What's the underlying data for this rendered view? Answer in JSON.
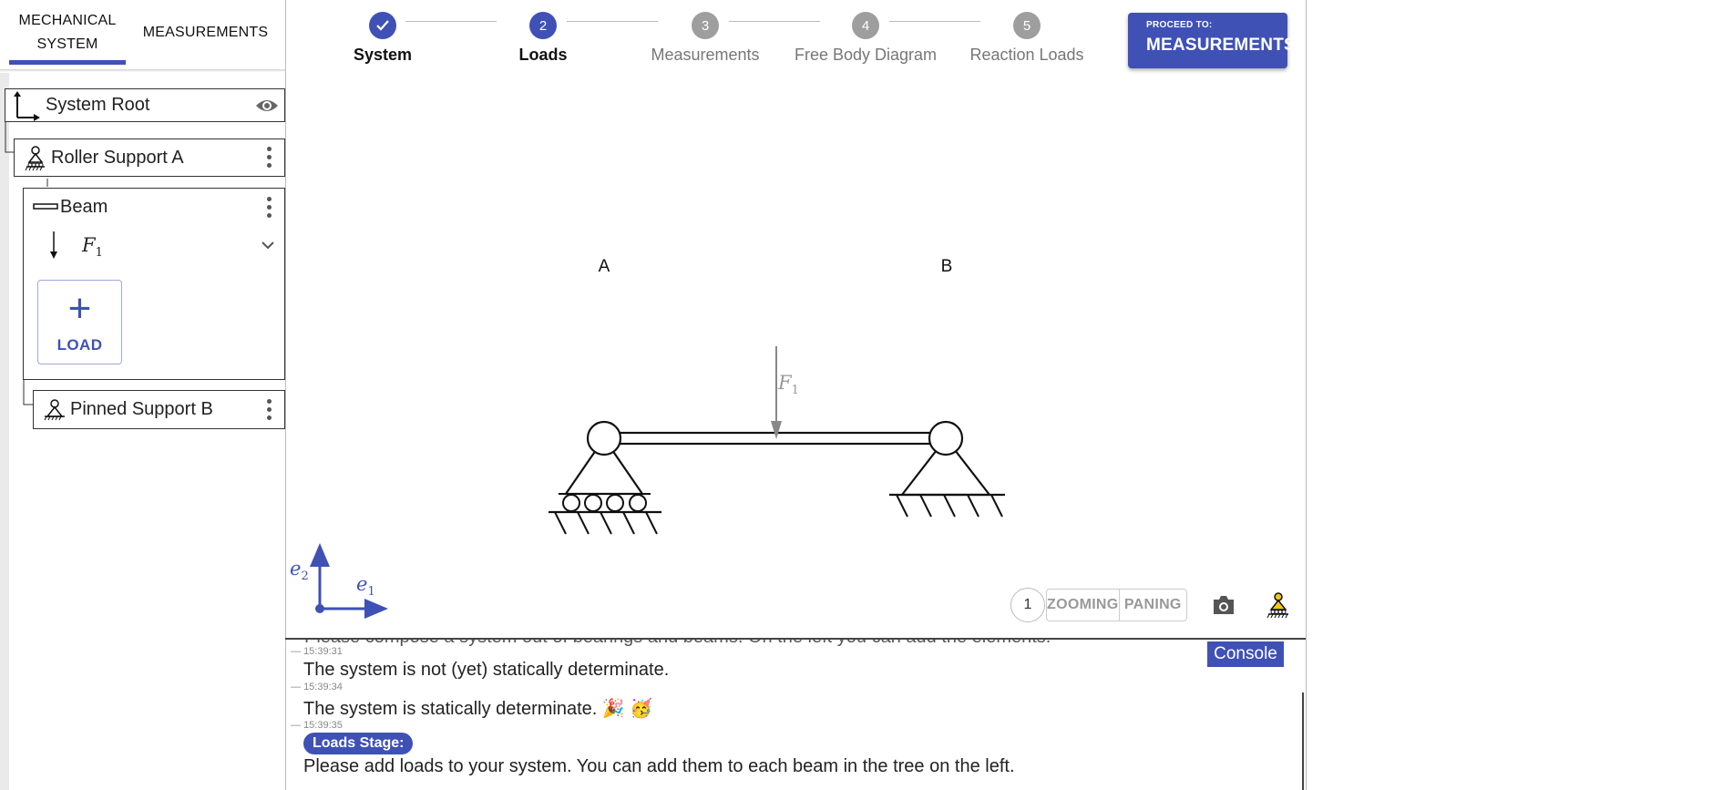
{
  "tabs": {
    "mechanical_line1": "MECHANICAL",
    "mechanical_line2": "SYSTEM",
    "measurements": "MEASUREMENTS"
  },
  "tree": {
    "root": "System Root",
    "roller": "Roller Support A",
    "beam": "Beam",
    "load_symbol": "F",
    "load_sub": "1",
    "add_load": "LOAD",
    "pinned": "Pinned Support B"
  },
  "stepper": {
    "steps": [
      {
        "num": "",
        "label": "System",
        "state": "done"
      },
      {
        "num": "2",
        "label": "Loads",
        "state": "active"
      },
      {
        "num": "3",
        "label": "Measurements",
        "state": "todo"
      },
      {
        "num": "4",
        "label": "Free Body Diagram",
        "state": "todo"
      },
      {
        "num": "5",
        "label": "Reaction Loads",
        "state": "todo"
      }
    ]
  },
  "proceed": {
    "prefix": "PROCEED TO:",
    "target": "MEASUREMENTS"
  },
  "canvas": {
    "label_a": "A",
    "label_b": "B",
    "force_symbol": "F",
    "force_sub": "1",
    "axis_e1": "e",
    "axis_e1_sub": "1",
    "axis_e2": "e",
    "axis_e2_sub": "2"
  },
  "controls": {
    "zoom_level": "1",
    "zooming": "ZOOMING",
    "paning": "PANING"
  },
  "console": {
    "button": "Console",
    "cut_line": "Please compose a system out of bearings and beams. On the left you can add the elements.",
    "entries": [
      {
        "time": "15:39:31",
        "text": "The system is not (yet) statically determinate."
      },
      {
        "time": "15:39:34",
        "text": "The system is statically determinate. 🎉 🥳"
      },
      {
        "time": "15:39:35",
        "badge": "Loads Stage:",
        "text": "Please add loads to your system. You can add them to each beam in the tree on the left."
      }
    ]
  },
  "colors": {
    "accent": "#3f51b5",
    "inactive_step": "#9e9e9e"
  }
}
